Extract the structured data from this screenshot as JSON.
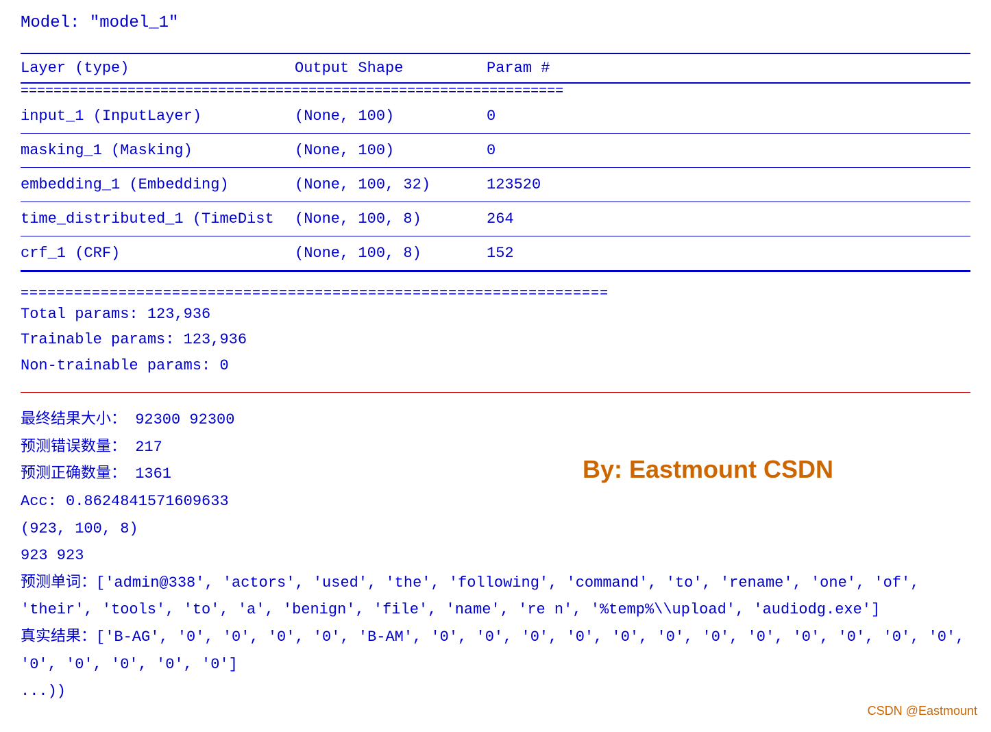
{
  "model": {
    "title": "Model: \"model_1\"",
    "table": {
      "headers": [
        "Layer (type)",
        "Output Shape",
        "Param #"
      ],
      "rows": [
        {
          "layer": "input_1 (InputLayer)",
          "output": "(None, 100)",
          "params": "0"
        },
        {
          "layer": "masking_1 (Masking)",
          "output": "(None, 100)",
          "params": "0"
        },
        {
          "layer": "embedding_1 (Embedding)",
          "output": "(None, 100, 32)",
          "params": "123520"
        },
        {
          "layer": "time_distributed_1 (TimeDist",
          "output": "(None, 100, 8)",
          "params": "264"
        },
        {
          "layer": "crf_1 (CRF)",
          "output": "(None, 100, 8)",
          "params": "152"
        }
      ]
    },
    "params": {
      "total": "Total params: 123,936",
      "trainable": "Trainable params: 123,936",
      "non_trainable": "Non-trainable params: 0"
    }
  },
  "results": {
    "final_size": "最终结果大小： 92300 92300",
    "pred_errors": "预测错误数量： 217",
    "pred_correct": "预测正确数量： 1361",
    "acc": "Acc: 0.8624841571609633",
    "shape": "(923, 100, 8)",
    "counts": "923 923",
    "pred_words": "预测单词：['admin@338', 'actors', 'used', 'the', 'following', 'command', 'to', 'rename', 'one', 'of', 'their', 'tools', 'to', 'a', 'benign', 'file', 'name', 're n', '%temp%\\\\upload', 'audiodg.exe']",
    "true_result": "真实结果：['B-AG', '0', '0', '0', '0', 'B-AM', '0', '0', '0', '0', '0', '0', '0', '0', '0', '0', '0', '0', '0', '0', '0', '0', '0']",
    "ellipsis": "...))"
  },
  "watermark": {
    "text": "By: Eastmount CSDN"
  },
  "csdn_badge": {
    "text": "CSDN @Eastmount"
  },
  "equal_separator": "=================================================================="
}
